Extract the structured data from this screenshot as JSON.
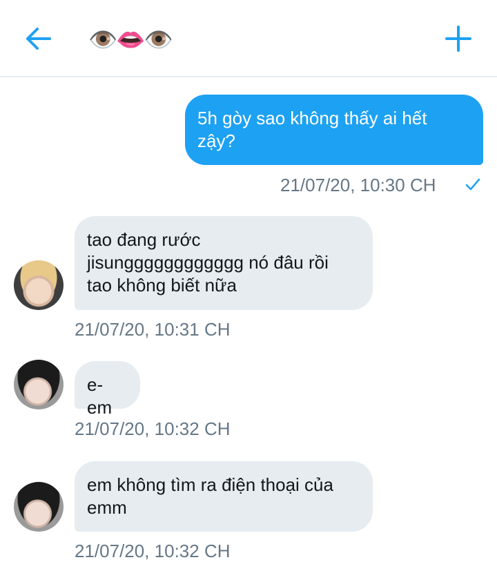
{
  "header": {
    "title": "👁️👄👁️",
    "back_label": "Back",
    "add_label": "New"
  },
  "colors": {
    "accent": "#1da1f2",
    "bubble_received": "#e6ecf0",
    "timestamp": "#657786"
  },
  "messages": [
    {
      "direction": "sent",
      "lines": [
        "5h gòy sao không thấy ai hết",
        "zậy?"
      ],
      "time": "21/07/20, 10:30 CH",
      "status": "check-icon"
    },
    {
      "direction": "received",
      "lines": [
        "tao đang rước",
        "jisungggggggggggg nó đâu rồi",
        "tao không biết nữa"
      ],
      "time": "21/07/20, 10:31 CH",
      "avatar": "avatar-blond"
    },
    {
      "direction": "received",
      "lines": [
        "e-em"
      ],
      "time": "21/07/20, 10:32 CH",
      "avatar": "avatar-dark"
    },
    {
      "direction": "received",
      "lines": [
        "em không tìm ra điện thoại của",
        "emm"
      ],
      "time": "21/07/20, 10:32 CH",
      "avatar": "avatar-dark"
    }
  ]
}
